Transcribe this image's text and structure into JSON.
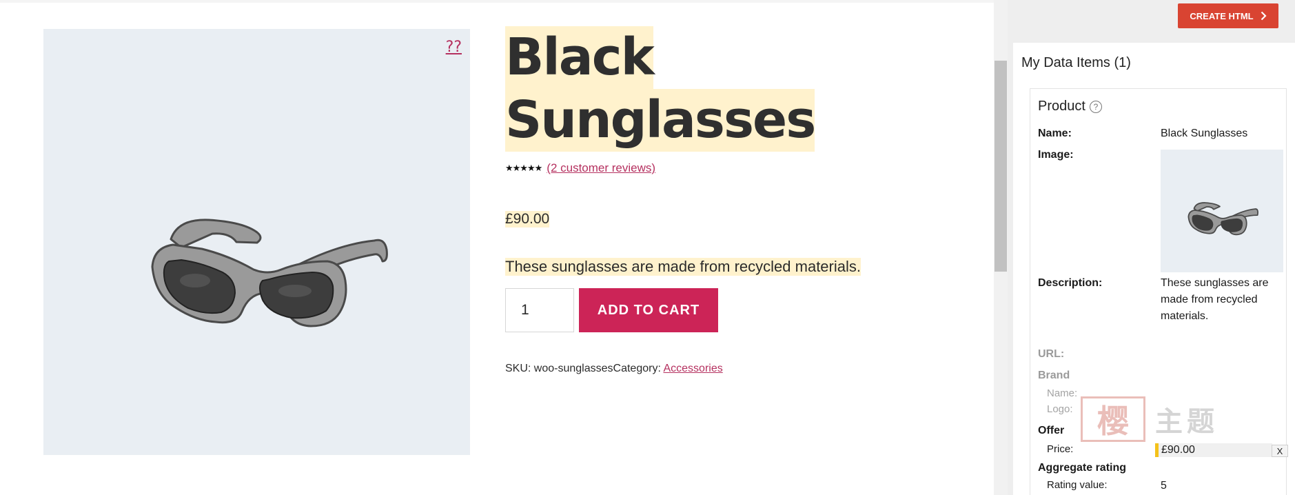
{
  "product": {
    "zoom_link": "??",
    "title_line1": "Black",
    "title_line2": "Sunglasses",
    "stars": "★★★★★",
    "reviews_link": "(2 customer reviews)",
    "price": "£90.00",
    "description": "These sunglasses are made from recycled materials.",
    "quantity": "1",
    "add_to_cart": "ADD TO CART",
    "sku_label": "SKU:",
    "sku": "woo-sunglasses",
    "category_label": "Category:",
    "category": "Accessories"
  },
  "panel": {
    "create_button": "CREATE HTML",
    "heading": "My Data Items (1)",
    "card": {
      "title": "Product",
      "help_icon": "?",
      "name_label": "Name:",
      "name_value": "Black Sunglasses",
      "image_label": "Image:",
      "description_label": "Description:",
      "description_value": "These sunglasses are made from recycled materials.",
      "url_label": "URL:",
      "brand_label": "Brand",
      "brand_name_label": "Name:",
      "brand_logo_label": "Logo:",
      "offer_label": "Offer",
      "price_label": "Price:",
      "price_value": "£90.00",
      "rating_label": "Aggregate rating",
      "rating_value_label": "Rating value:",
      "rating_value": "5"
    },
    "close": "X"
  },
  "watermark": {
    "seal": "樱",
    "text": "主题"
  },
  "colors": {
    "accent": "#cc2457",
    "link": "#b5305f",
    "highlight": "#fff2cd",
    "create_button": "#d94432",
    "gallery_bg": "#e9eef3"
  },
  "icons": [
    "help-icon",
    "chevron-right-icon",
    "sunglasses-image"
  ]
}
